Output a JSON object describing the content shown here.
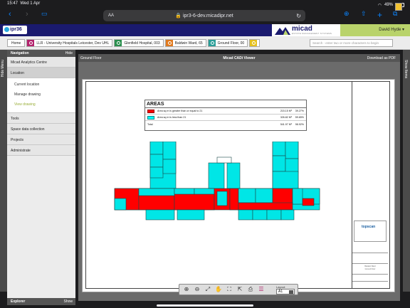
{
  "status": {
    "time": "15:47",
    "date": "Wed 1 Apr",
    "battery": "49%"
  },
  "browser": {
    "text_size": "AA",
    "url": "ipr3-6-dev.micadipr.net"
  },
  "header": {
    "logo_left": "ipr36",
    "brand": "micad",
    "brand_tagline": "ESTATE MANAGEMENT SYSTEMS",
    "user": "David Hyde",
    "colors": {
      "header_bg": "#1a1a6e",
      "user_bg": "#b9d36b"
    }
  },
  "breadcrumb": [
    {
      "label": "Home",
      "color": ""
    },
    {
      "label": "LLR - University Hospitals Leicester, Dev UHL",
      "color": "#b3236d"
    },
    {
      "label": "Glenfield Hospital, 003",
      "color": "#2b8f4e"
    },
    {
      "label": "Baldwin Ward, 65",
      "color": "#e07a1f"
    },
    {
      "label": "Ground Floor, 00",
      "color": "#2a9e98"
    },
    {
      "label": "",
      "color": "#e6c21e"
    }
  ],
  "search": {
    "placeholder": "Search - enter two or more characters to begin"
  },
  "sidetabs": {
    "left": "Hide Menu",
    "right": "Show Items"
  },
  "navigation": {
    "title": "Navigation",
    "hide": "Hide",
    "items": [
      {
        "label": "Micad Analytics Centre"
      },
      {
        "label": "Location"
      }
    ],
    "location_sub": [
      "Current location",
      "Manage drawing",
      "View drawing"
    ],
    "items_after": [
      {
        "label": "Tools"
      },
      {
        "label": "Space data collection"
      },
      {
        "label": "Projects"
      },
      {
        "label": "Administrate"
      }
    ],
    "explorer": "Explorer",
    "show": "Show"
  },
  "viewer": {
    "floor": "Ground Floor",
    "title": "Micad CADi Viewer",
    "download": "Download as PDF"
  },
  "areas_table": {
    "title": "AREAS",
    "rows": [
      {
        "color": "#ff0000",
        "label": "Area sq m is greater than or equal to 21",
        "value": "215.15 M²",
        "pct": "39.27%"
      },
      {
        "color": "#00ffff",
        "label": "Area sq m is less than 21",
        "value": "326.82 M²",
        "pct": "59.65%"
      },
      {
        "color": "",
        "label": "Total",
        "value": "541.97 M²",
        "pct": "98.92%"
      }
    ]
  },
  "titleblock": {
    "logo": "topscan",
    "line1": "Baldwin Ward",
    "line2": "Ground Floor"
  },
  "toolbar": {
    "icons": [
      "zoom-in-icon",
      "zoom-out-icon",
      "zoom-extents-icon",
      "pan-icon",
      "fullscreen-icon",
      "export-icon",
      "print-icon",
      "layers-icon"
    ],
    "layout_label": "Layout:",
    "layout_value": "A1"
  }
}
